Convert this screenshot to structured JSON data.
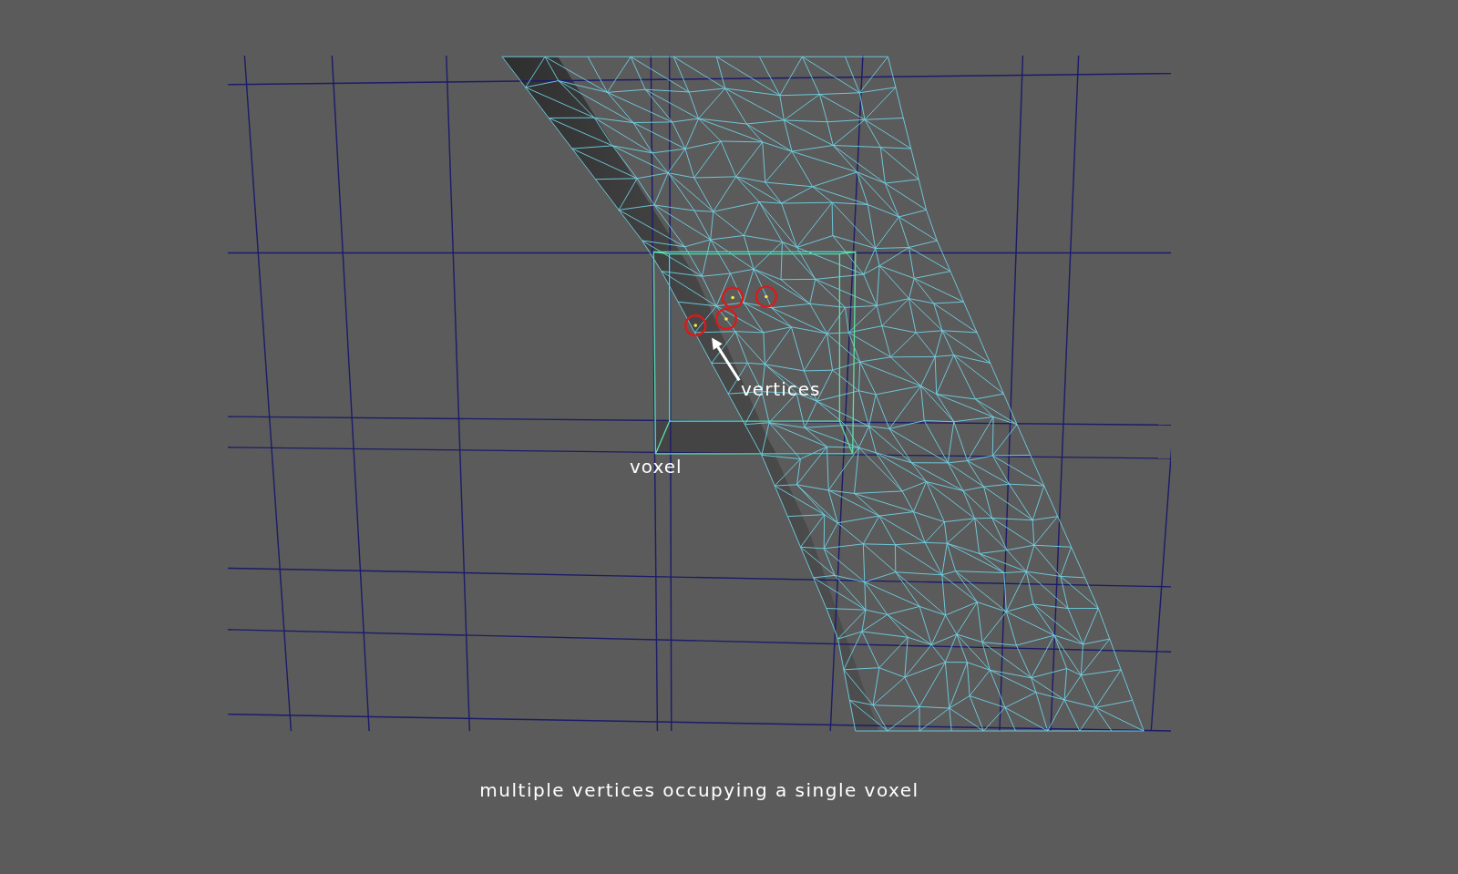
{
  "viewport": {
    "labels": [
      {
        "text": "vertices",
        "kind": "vertices"
      },
      {
        "text": "voxel",
        "kind": "voxel"
      }
    ]
  },
  "caption": "multiple vertices occupying a single voxel"
}
